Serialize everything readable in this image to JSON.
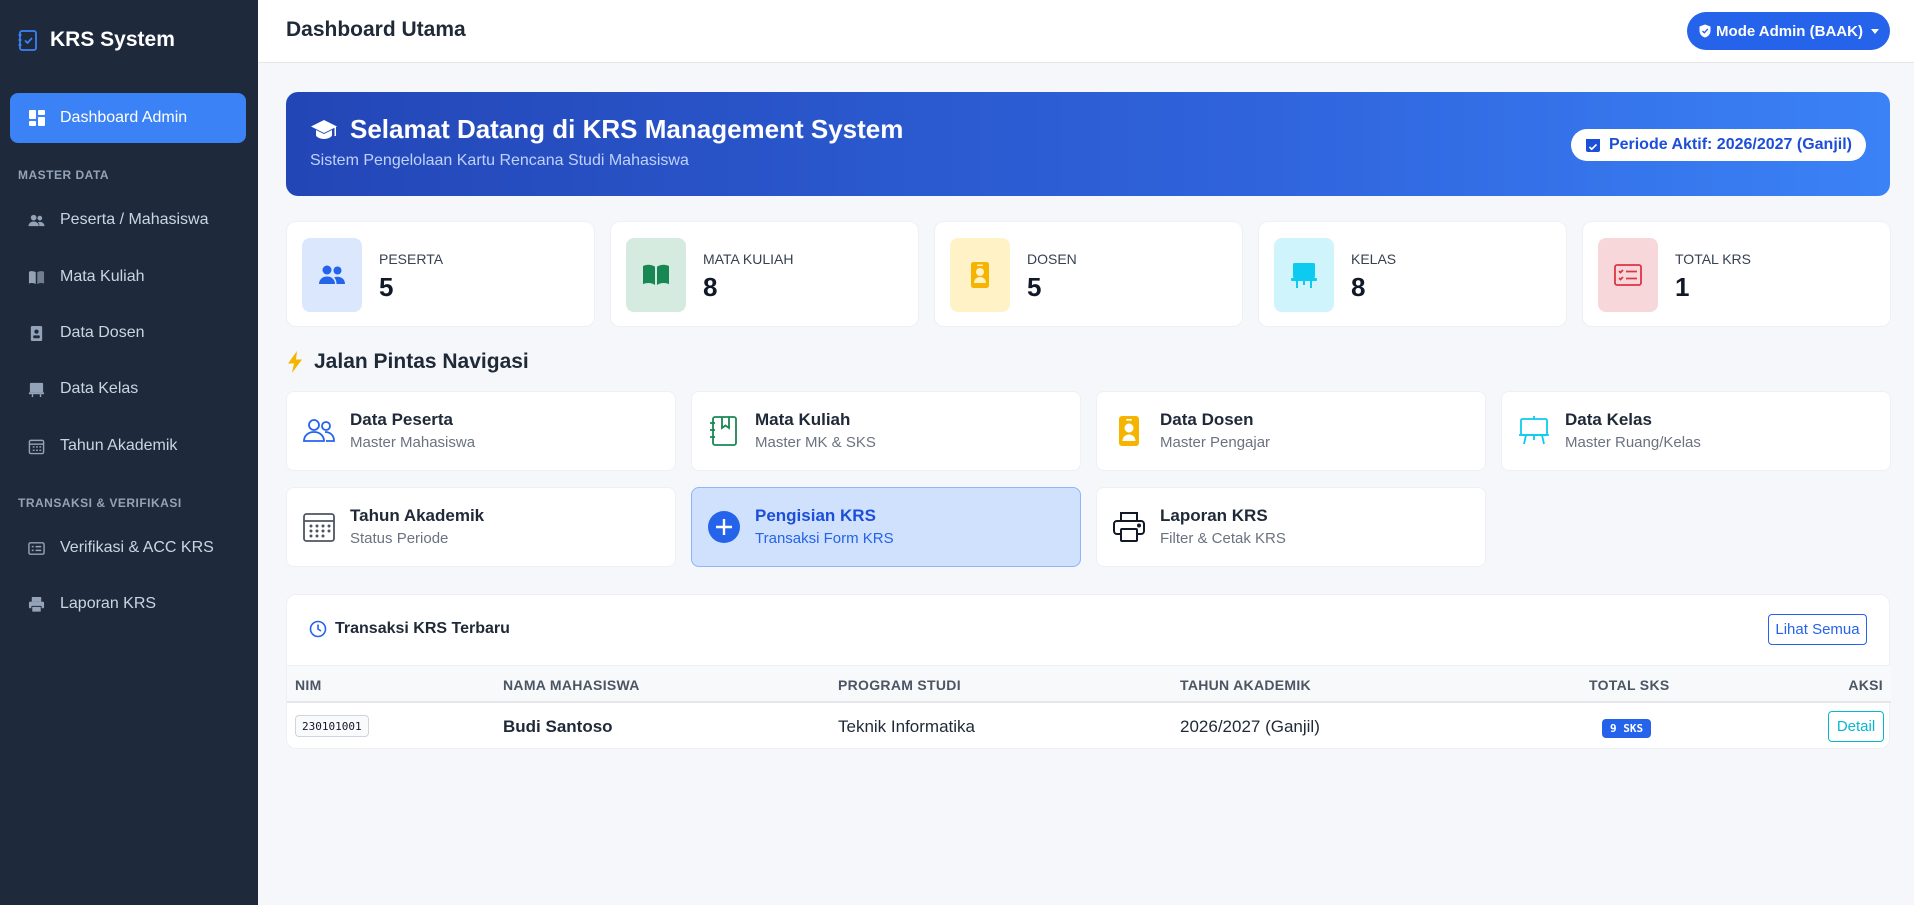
{
  "sidebar": {
    "brand": "KRS System",
    "active_item": "Dashboard Admin",
    "section_master": "MASTER DATA",
    "master_items": [
      "Peserta / Mahasiswa",
      "Mata Kuliah",
      "Data Dosen",
      "Data Kelas",
      "Tahun Akademik"
    ],
    "section_transaksi": "TRANSAKSI & VERIFIKASI",
    "transaksi_items": [
      "Verifikasi & ACC KRS",
      "Laporan KRS"
    ]
  },
  "topbar": {
    "title": "Dashboard Utama",
    "mode_button": "Mode Admin (BAAK)"
  },
  "hero": {
    "title": "Selamat Datang di KRS Management System",
    "subtitle": "Sistem Pengelolaan Kartu Rencana Studi Mahasiswa",
    "periode": "Periode Aktif: 2026/2027 (Ganjil)"
  },
  "stats": [
    {
      "label": "PESERTA",
      "value": "5",
      "icon": "users-icon",
      "bg": "#dbe7fd",
      "color": "#2563eb"
    },
    {
      "label": "MATA KULIAH",
      "value": "8",
      "icon": "book-icon",
      "bg": "#d5ebe0",
      "color": "#198754"
    },
    {
      "label": "DOSEN",
      "value": "5",
      "icon": "badge-icon",
      "bg": "#fff2c7",
      "color": "#f5b400"
    },
    {
      "label": "KELAS",
      "value": "8",
      "icon": "easel-icon",
      "bg": "#cff4fc",
      "color": "#0dcaf0"
    },
    {
      "label": "TOTAL KRS",
      "value": "1",
      "icon": "card-checklist-icon",
      "bg": "#f8d7da",
      "color": "#dc3545"
    }
  ],
  "shortcuts": {
    "title": "Jalan Pintas Navigasi",
    "items": [
      {
        "name": "Data Peserta",
        "desc": "Master Mahasiswa",
        "icon": "people-icon",
        "color": "#2563eb"
      },
      {
        "name": "Mata Kuliah",
        "desc": "Master MK & SKS",
        "icon": "journal-icon",
        "color": "#198754"
      },
      {
        "name": "Data Dosen",
        "desc": "Master Pengajar",
        "icon": "person-badge-icon",
        "color": "#f5b400"
      },
      {
        "name": "Data Kelas",
        "desc": "Master Ruang/Kelas",
        "icon": "easel-icon",
        "color": "#0dcaf0"
      },
      {
        "name": "Tahun Akademik",
        "desc": "Status Periode",
        "icon": "calendar-icon",
        "color": "#4b5563"
      },
      {
        "name": "Pengisian KRS",
        "desc": "Transaksi Form KRS",
        "icon": "plus-circle-icon",
        "color": "#2563eb"
      },
      {
        "name": "Laporan KRS",
        "desc": "Filter & Cetak KRS",
        "icon": "printer-icon",
        "color": "#111827"
      }
    ]
  },
  "recent": {
    "title": "Transaksi KRS Terbaru",
    "view_all": "Lihat Semua",
    "headers": [
      "NIM",
      "NAMA MAHASISWA",
      "PROGRAM STUDI",
      "TAHUN AKADEMIK",
      "TOTAL SKS",
      "AKSI"
    ],
    "rows": [
      {
        "nim": "230101001",
        "nama": "Budi Santoso",
        "prodi": "Teknik Informatika",
        "tahun": "2026/2027 (Ganjil)",
        "sks": "9 SKS",
        "aksi": "Detail"
      }
    ]
  }
}
